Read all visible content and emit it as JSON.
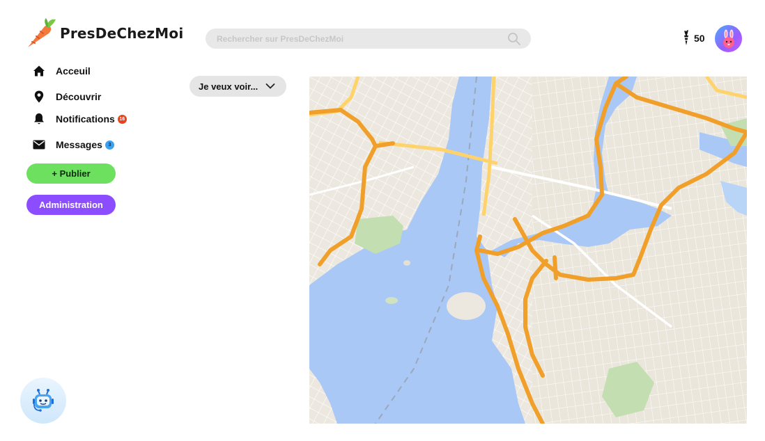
{
  "app": {
    "name": "PresDeChezMoi"
  },
  "search": {
    "placeholder": "Rechercher sur PresDeChezMoi"
  },
  "user": {
    "coins": "50"
  },
  "sidebar": {
    "items": [
      {
        "label": "Acceuil",
        "icon": "home-icon"
      },
      {
        "label": "Découvrir",
        "icon": "location-pin-icon"
      },
      {
        "label": "Notifications",
        "icon": "bell-icon",
        "badge": "16"
      },
      {
        "label": "Messages",
        "icon": "envelope-icon",
        "badge": "3"
      }
    ],
    "publish_label": "+ Publier",
    "admin_label": "Administration"
  },
  "filter": {
    "label": "Je veux voir..."
  },
  "colors": {
    "publish": "#6ee05f",
    "admin": "#8b4dff",
    "badge_notifications": "#e8431f",
    "badge_messages": "#3aa0f0",
    "water": "#a9c8f5",
    "highway": "#f0a02a"
  }
}
